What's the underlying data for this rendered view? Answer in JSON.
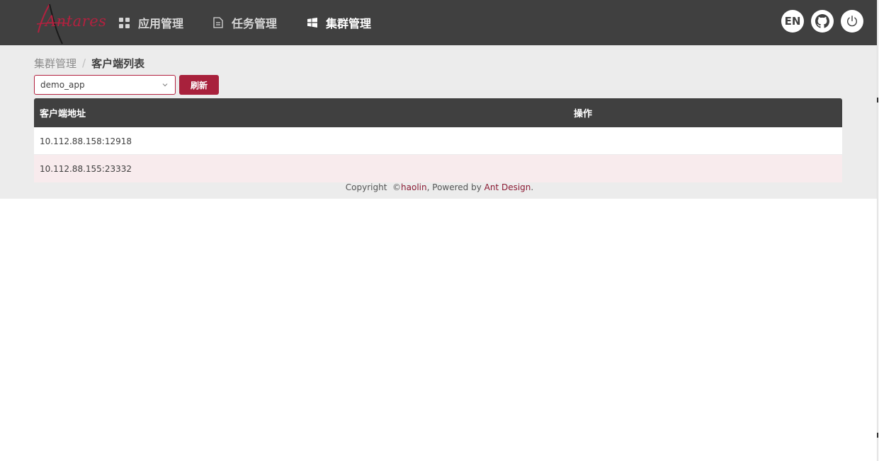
{
  "header": {
    "logo_text": "Antares",
    "nav": [
      {
        "label": "应用管理",
        "icon": "appstore-icon"
      },
      {
        "label": "任务管理",
        "icon": "file-text-icon"
      },
      {
        "label": "集群管理",
        "icon": "windows-icon"
      }
    ],
    "active_nav": "集群管理",
    "lang_button": "EN",
    "github_icon": "github-icon",
    "power_icon": "power-icon"
  },
  "breadcrumb": {
    "parent": "集群管理",
    "separator": "/",
    "current": "客户端列表"
  },
  "toolbar": {
    "app_select_value": "demo_app",
    "refresh_label": "刷新"
  },
  "table": {
    "columns": [
      "客户端地址",
      "操作"
    ],
    "rows": [
      {
        "address": "10.112.88.158:12918",
        "action": ""
      },
      {
        "address": "10.112.88.155:23332",
        "action": ""
      }
    ]
  },
  "footer": {
    "prefix": "Copyright  ©",
    "author": "haolin",
    "middle": ", Powered by ",
    "framework": "Ant Design",
    "suffix": "."
  },
  "colors": {
    "header_bg": "#404040",
    "accent": "#a8213c",
    "page_bg": "#ececec",
    "row_alt": "#f8ebed"
  }
}
